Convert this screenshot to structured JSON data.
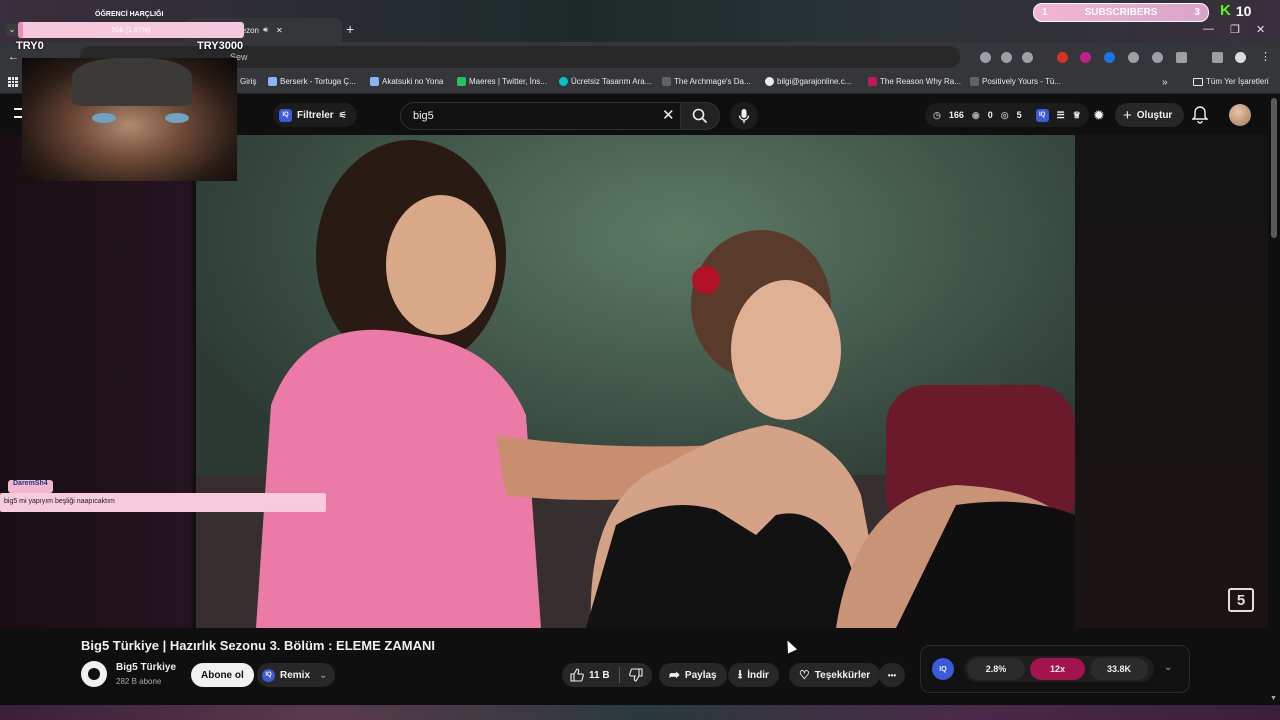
{
  "stream_overlay": {
    "goal_title": "ÖĞRENCİ HARÇLIĞI",
    "goal_progress_text": "50₺ (1.67%)",
    "goal_progress": 0.0167,
    "goal_start": "TRY0",
    "goal_end": "TRY3000",
    "subs_current": "1",
    "subs_label": "SUBSCRIBERS",
    "subs_target": "3",
    "kick_count": "10",
    "chat_user": "DaremSh4",
    "chat_message": "big5 mi yapıyım beşliği naapıcaktım"
  },
  "browser": {
    "active_tab": "ye | Hazırlık Sezon",
    "url_fragment": "Sew",
    "bookmarks": [
      {
        "label": "Giriş"
      },
      {
        "label": "Berserk - Tortuga Ç..."
      },
      {
        "label": "Akatsuki no Yona"
      },
      {
        "label": "Maeres | Twitter, İns..."
      },
      {
        "label": "Ücretsiz Tasarım Ara..."
      },
      {
        "label": "The Archmage's Da..."
      },
      {
        "label": "bilgi@garajonline.c..."
      },
      {
        "label": "The Reason Why Ra..."
      },
      {
        "label": "Positively Yours - Tü..."
      }
    ],
    "bookmarks_more": "»",
    "all_bookmarks": "Tüm Yer İşaretleri"
  },
  "header": {
    "filters_label": "Filtreler",
    "iq_label": "IQ",
    "search_value": "big5",
    "stats": [
      "166",
      "0",
      "5"
    ],
    "create_label": "Oluştur"
  },
  "video": {
    "title": "Big5 Türkiye | Hazırlık Sezonu 3. Bölüm : ELEME ZAMANI",
    "channel_name": "Big5 Türkiye",
    "channel_subs": "282 B abone",
    "subscribe_label": "Abone ol",
    "remix_label": "Remix",
    "likes": "11 B",
    "share_label": "Paylaş",
    "download_label": "İndir",
    "thanks_label": "Teşekkürler",
    "more_label": "•••",
    "channel_watermark": "5"
  },
  "iq_panel": {
    "iq_label": "IQ",
    "pct": "2.8%",
    "speed": "12x",
    "views": "33.8K",
    "accent": "#a3134d"
  }
}
